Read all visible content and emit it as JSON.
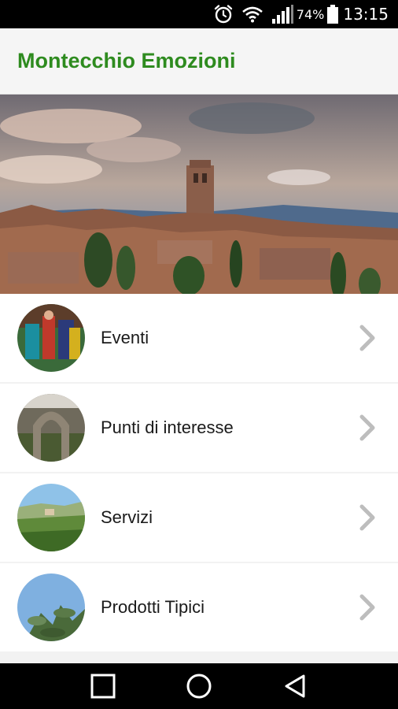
{
  "status_bar": {
    "battery": "74%",
    "time": "13:15",
    "icons": [
      "alarm-icon",
      "wifi-icon",
      "signal-icon",
      "battery-icon"
    ]
  },
  "app_bar": {
    "title": "Montecchio Emozioni",
    "title_color": "#2e8b1f"
  },
  "hero": {
    "image": "hero-village-photo"
  },
  "menu": {
    "items": [
      {
        "label": "Eventi",
        "icon": "chevron-right-icon"
      },
      {
        "label": "Punti di interesse",
        "icon": "chevron-right-icon"
      },
      {
        "label": "Servizi",
        "icon": "chevron-right-icon"
      },
      {
        "label": "Prodotti Tipici",
        "icon": "chevron-right-icon"
      }
    ]
  },
  "nav_bar": {
    "buttons": [
      "recent-apps-icon",
      "home-icon",
      "back-icon"
    ]
  }
}
